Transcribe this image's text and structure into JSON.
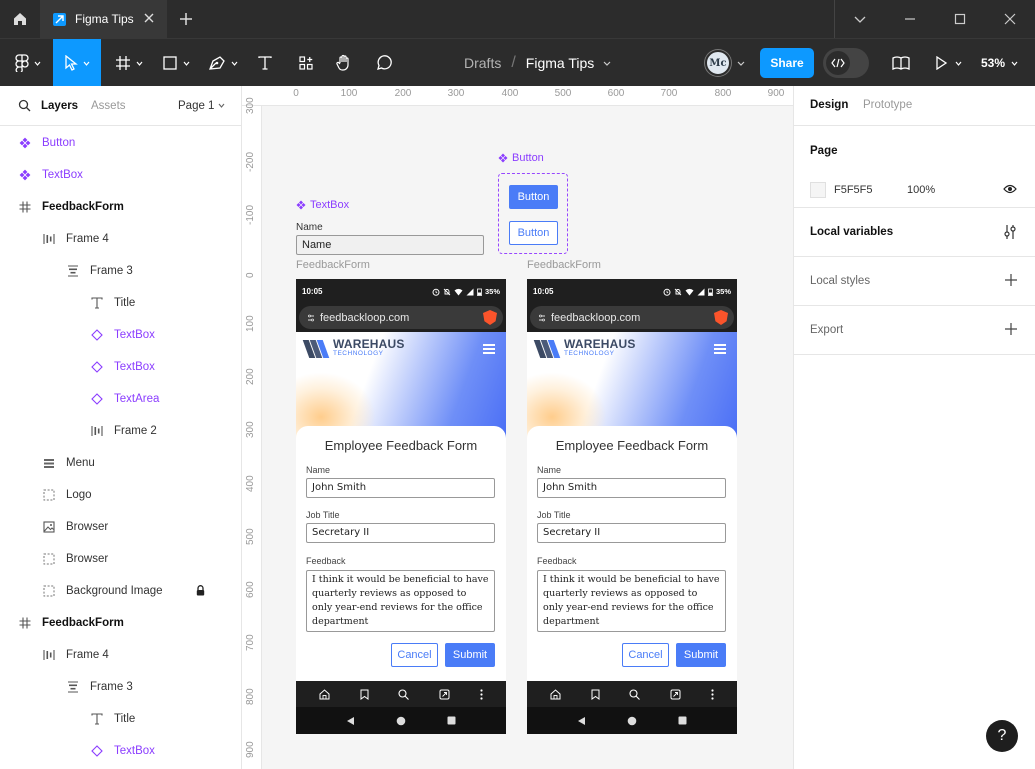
{
  "app": {
    "tab_title": "Figma Tips",
    "colors": {
      "accent": "#0d99ff",
      "component": "#8b3dff",
      "form_blue": "#4a7cf7"
    }
  },
  "toolbar": {
    "breadcrumb_drafts": "Drafts",
    "breadcrumb_sep": "/",
    "file_name": "Figma Tips",
    "avatar_initials": "Mc",
    "share_label": "Share",
    "zoom": "53%"
  },
  "left_panel": {
    "tab_layers": "Layers",
    "tab_assets": "Assets",
    "page_selector": "Page 1",
    "layers": [
      {
        "name": "Button",
        "icon": "component-icon"
      },
      {
        "name": "TextBox",
        "icon": "component-icon"
      },
      {
        "name": "FeedbackForm",
        "icon": "frame-icon"
      },
      {
        "name": "Frame 4",
        "icon": "auto-layout-horizontal-icon"
      },
      {
        "name": "Frame 3",
        "icon": "auto-layout-vertical-icon"
      },
      {
        "name": "Title",
        "icon": "text-icon"
      },
      {
        "name": "TextBox",
        "icon": "instance-icon"
      },
      {
        "name": "TextBox",
        "icon": "instance-icon"
      },
      {
        "name": "TextArea",
        "icon": "instance-icon"
      },
      {
        "name": "Frame 2",
        "icon": "auto-layout-horizontal-icon"
      },
      {
        "name": "Menu",
        "icon": "menu-stack-icon"
      },
      {
        "name": "Logo",
        "icon": "group-icon"
      },
      {
        "name": "Browser",
        "icon": "image-icon"
      },
      {
        "name": "Browser",
        "icon": "group-icon"
      },
      {
        "name": "Background Image",
        "icon": "group-icon"
      },
      {
        "name": "FeedbackForm",
        "icon": "frame-icon"
      },
      {
        "name": "Frame 4",
        "icon": "auto-layout-horizontal-icon"
      },
      {
        "name": "Frame 3",
        "icon": "auto-layout-vertical-icon"
      },
      {
        "name": "Title",
        "icon": "text-icon"
      },
      {
        "name": "TextBox",
        "icon": "instance-icon"
      }
    ]
  },
  "canvas": {
    "ruler_top": [
      "0",
      "100",
      "200",
      "300",
      "400",
      "500",
      "600",
      "700",
      "800",
      "900"
    ],
    "ruler_left": [
      "300",
      "-200",
      "-100",
      "0",
      "100",
      "200",
      "300",
      "400",
      "500",
      "600",
      "700",
      "800",
      "900"
    ],
    "textbox_component": {
      "label": "TextBox",
      "field_label": "Name",
      "field_value": "Name"
    },
    "button_component": {
      "label": "Button",
      "primary": "Button",
      "secondary": "Button"
    },
    "frame_labels": [
      "FeedbackForm",
      "FeedbackForm"
    ],
    "phone": {
      "time": "10:05",
      "battery": "35%",
      "url": "feedbackloop.com",
      "logo_line1": "WAREHAUS",
      "logo_line2": "TECHNOLOGY",
      "form_title": "Employee Feedback Form",
      "name_label": "Name",
      "name_value": "John Smith",
      "job_label": "Job Title",
      "job_value": "Secretary II",
      "feedback_label": "Feedback",
      "feedback_value": "I think it would be beneficial to have quarterly reviews as opposed to only year-end reviews for the office department",
      "cancel_label": "Cancel",
      "submit_label": "Submit"
    }
  },
  "right_panel": {
    "tab_design": "Design",
    "tab_prototype": "Prototype",
    "page_heading": "Page",
    "page_color_hex": "F5F5F5",
    "page_opacity": "100%",
    "local_variables": "Local variables",
    "local_styles": "Local styles",
    "export": "Export"
  },
  "help_label": "?"
}
